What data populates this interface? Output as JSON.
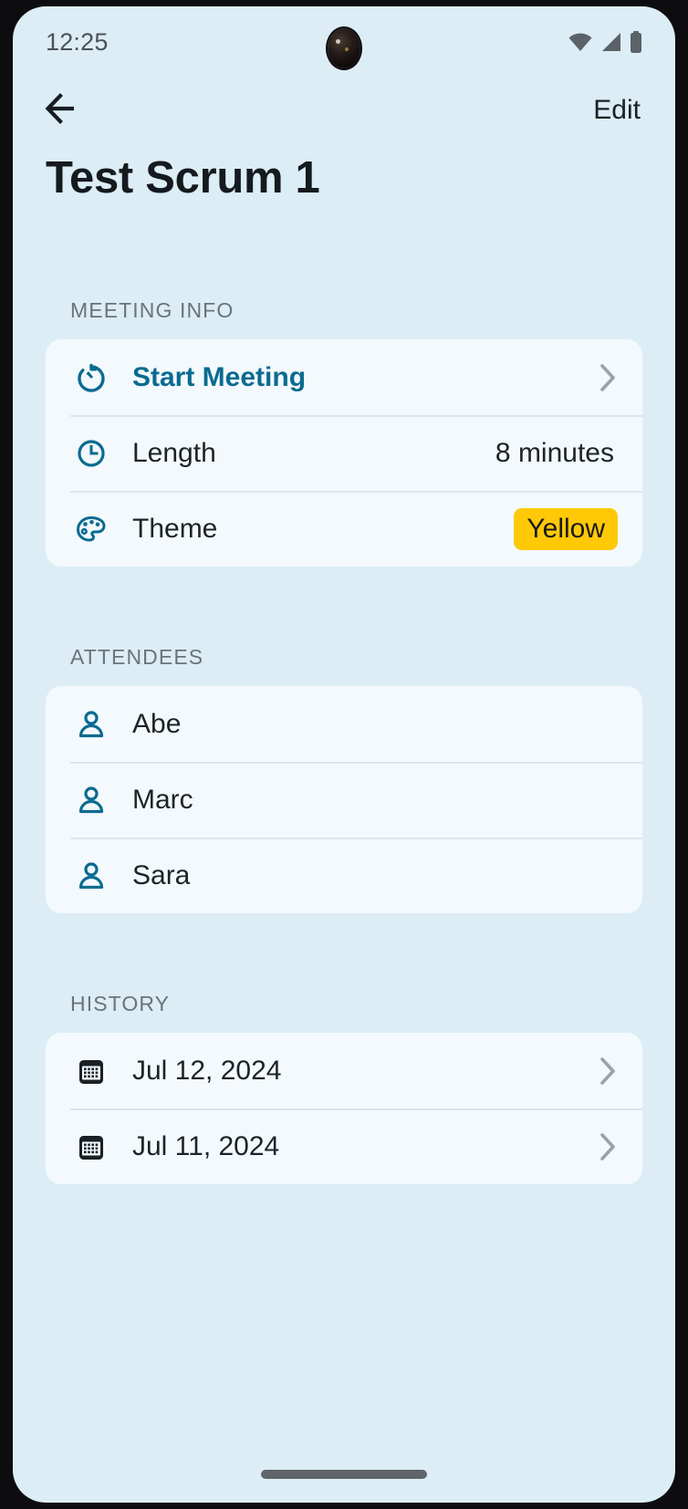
{
  "statusbar": {
    "time": "12:25",
    "icons": [
      "wifi-icon",
      "cell-signal-icon",
      "battery-icon"
    ]
  },
  "topnav": {
    "back_icon": "arrow-left-icon",
    "edit_label": "Edit"
  },
  "header": {
    "title": "Test Scrum 1"
  },
  "theme_color": "#FFC907",
  "accent_color": "#0a6b90",
  "sections": [
    {
      "label": "MEETING INFO",
      "rows": [
        {
          "icon": "stopwatch-icon",
          "label": "Start Meeting",
          "value": "",
          "accent": true,
          "chevron": true,
          "badge": false
        },
        {
          "icon": "clock-icon",
          "label": "Length",
          "value": "8 minutes",
          "accent": false,
          "chevron": false,
          "badge": false
        },
        {
          "icon": "palette-icon",
          "label": "Theme",
          "value": "Yellow",
          "accent": false,
          "chevron": false,
          "badge": true
        }
      ]
    },
    {
      "label": "ATTENDEES",
      "rows": [
        {
          "icon": "person-icon",
          "label": "Abe",
          "value": "",
          "accent": false,
          "chevron": false,
          "badge": false
        },
        {
          "icon": "person-icon",
          "label": "Marc",
          "value": "",
          "accent": false,
          "chevron": false,
          "badge": false
        },
        {
          "icon": "person-icon",
          "label": "Sara",
          "value": "",
          "accent": false,
          "chevron": false,
          "badge": false
        }
      ]
    },
    {
      "label": "HISTORY",
      "rows": [
        {
          "icon": "calendar-icon",
          "label": "Jul 12, 2024",
          "value": "",
          "accent": false,
          "chevron": true,
          "badge": false
        },
        {
          "icon": "calendar-icon",
          "label": "Jul 11, 2024",
          "value": "",
          "accent": false,
          "chevron": true,
          "badge": false
        }
      ]
    }
  ]
}
